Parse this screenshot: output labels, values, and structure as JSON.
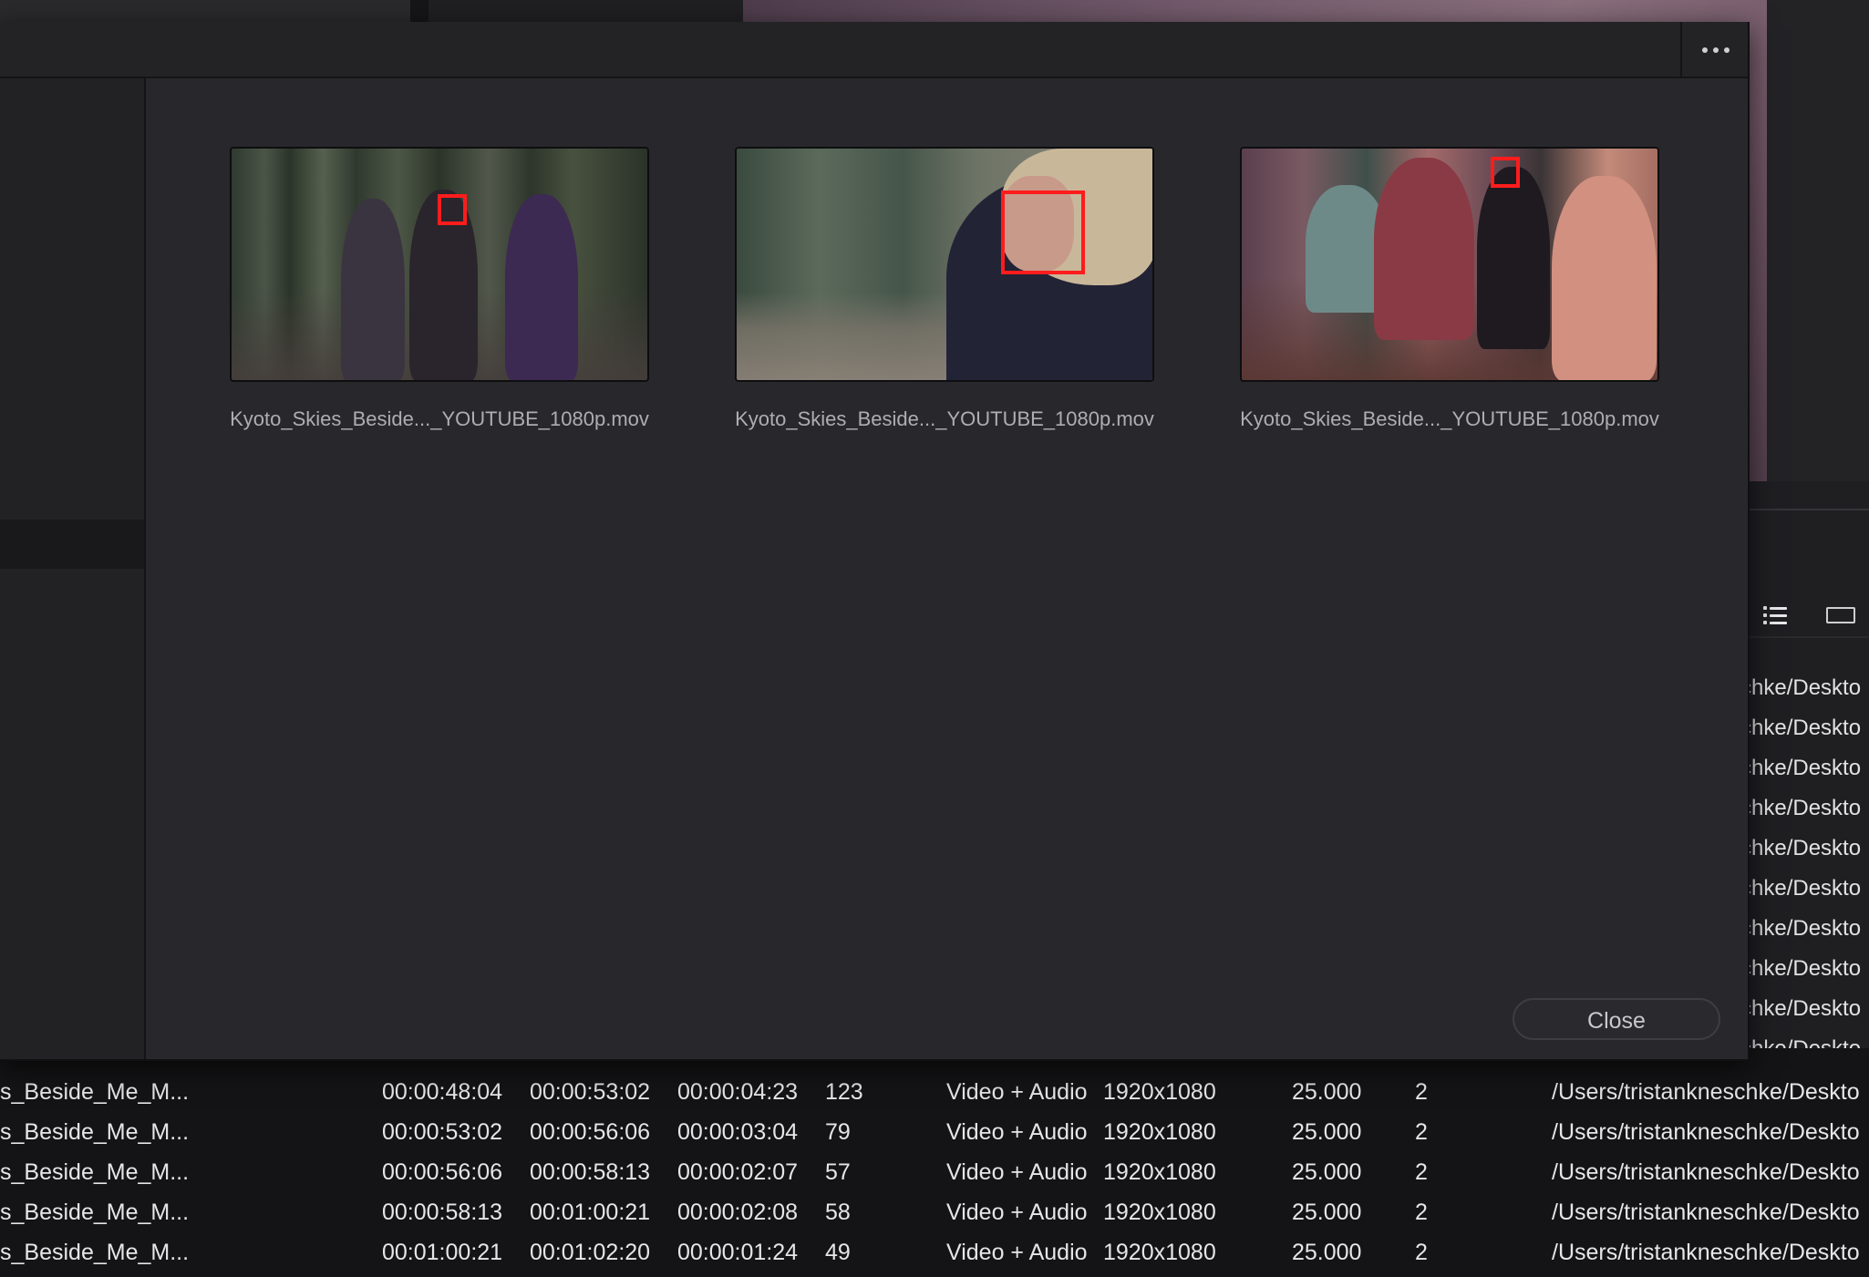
{
  "dialog": {
    "clips": [
      {
        "label": "Kyoto_Skies_Beside..._YOUTUBE_1080p.mov"
      },
      {
        "label": "Kyoto_Skies_Beside..._YOUTUBE_1080p.mov"
      },
      {
        "label": "Kyoto_Skies_Beside..._YOUTUBE_1080p.mov"
      }
    ],
    "close_label": "Close"
  },
  "right_panel": {
    "path_fragments": [
      "chke/Deskto",
      "chke/Deskto",
      "chke/Deskto",
      "chke/Deskto",
      "chke/Deskto",
      "chke/Deskto",
      "chke/Deskto",
      "chke/Deskto",
      "chke/Deskto",
      "chke/Deskto"
    ]
  },
  "table": {
    "rows": [
      {
        "name": "s_Beside_Me_M...",
        "start": "00:00:48:04",
        "end": "00:00:53:02",
        "duration": "00:00:04:23",
        "frames": "123",
        "type": "Video + Audio",
        "resolution": "1920x1080",
        "fps": "25.000",
        "audio_ch": "2",
        "path": "/Users/tristankneschke/Deskto"
      },
      {
        "name": "s_Beside_Me_M...",
        "start": "00:00:53:02",
        "end": "00:00:56:06",
        "duration": "00:00:03:04",
        "frames": "79",
        "type": "Video + Audio",
        "resolution": "1920x1080",
        "fps": "25.000",
        "audio_ch": "2",
        "path": "/Users/tristankneschke/Deskto"
      },
      {
        "name": "s_Beside_Me_M...",
        "start": "00:00:56:06",
        "end": "00:00:58:13",
        "duration": "00:00:02:07",
        "frames": "57",
        "type": "Video + Audio",
        "resolution": "1920x1080",
        "fps": "25.000",
        "audio_ch": "2",
        "path": "/Users/tristankneschke/Deskto"
      },
      {
        "name": "s_Beside_Me_M...",
        "start": "00:00:58:13",
        "end": "00:01:00:21",
        "duration": "00:00:02:08",
        "frames": "58",
        "type": "Video + Audio",
        "resolution": "1920x1080",
        "fps": "25.000",
        "audio_ch": "2",
        "path": "/Users/tristankneschke/Deskto"
      },
      {
        "name": "s_Beside_Me_M...",
        "start": "00:01:00:21",
        "end": "00:01:02:20",
        "duration": "00:00:01:24",
        "frames": "49",
        "type": "Video + Audio",
        "resolution": "1920x1080",
        "fps": "25.000",
        "audio_ch": "2",
        "path": "/Users/tristankneschke/Deskto"
      }
    ]
  },
  "colors": {
    "face_box": "#ff1c1c",
    "dialog_bg": "#28282c",
    "table_bg": "#141416"
  }
}
